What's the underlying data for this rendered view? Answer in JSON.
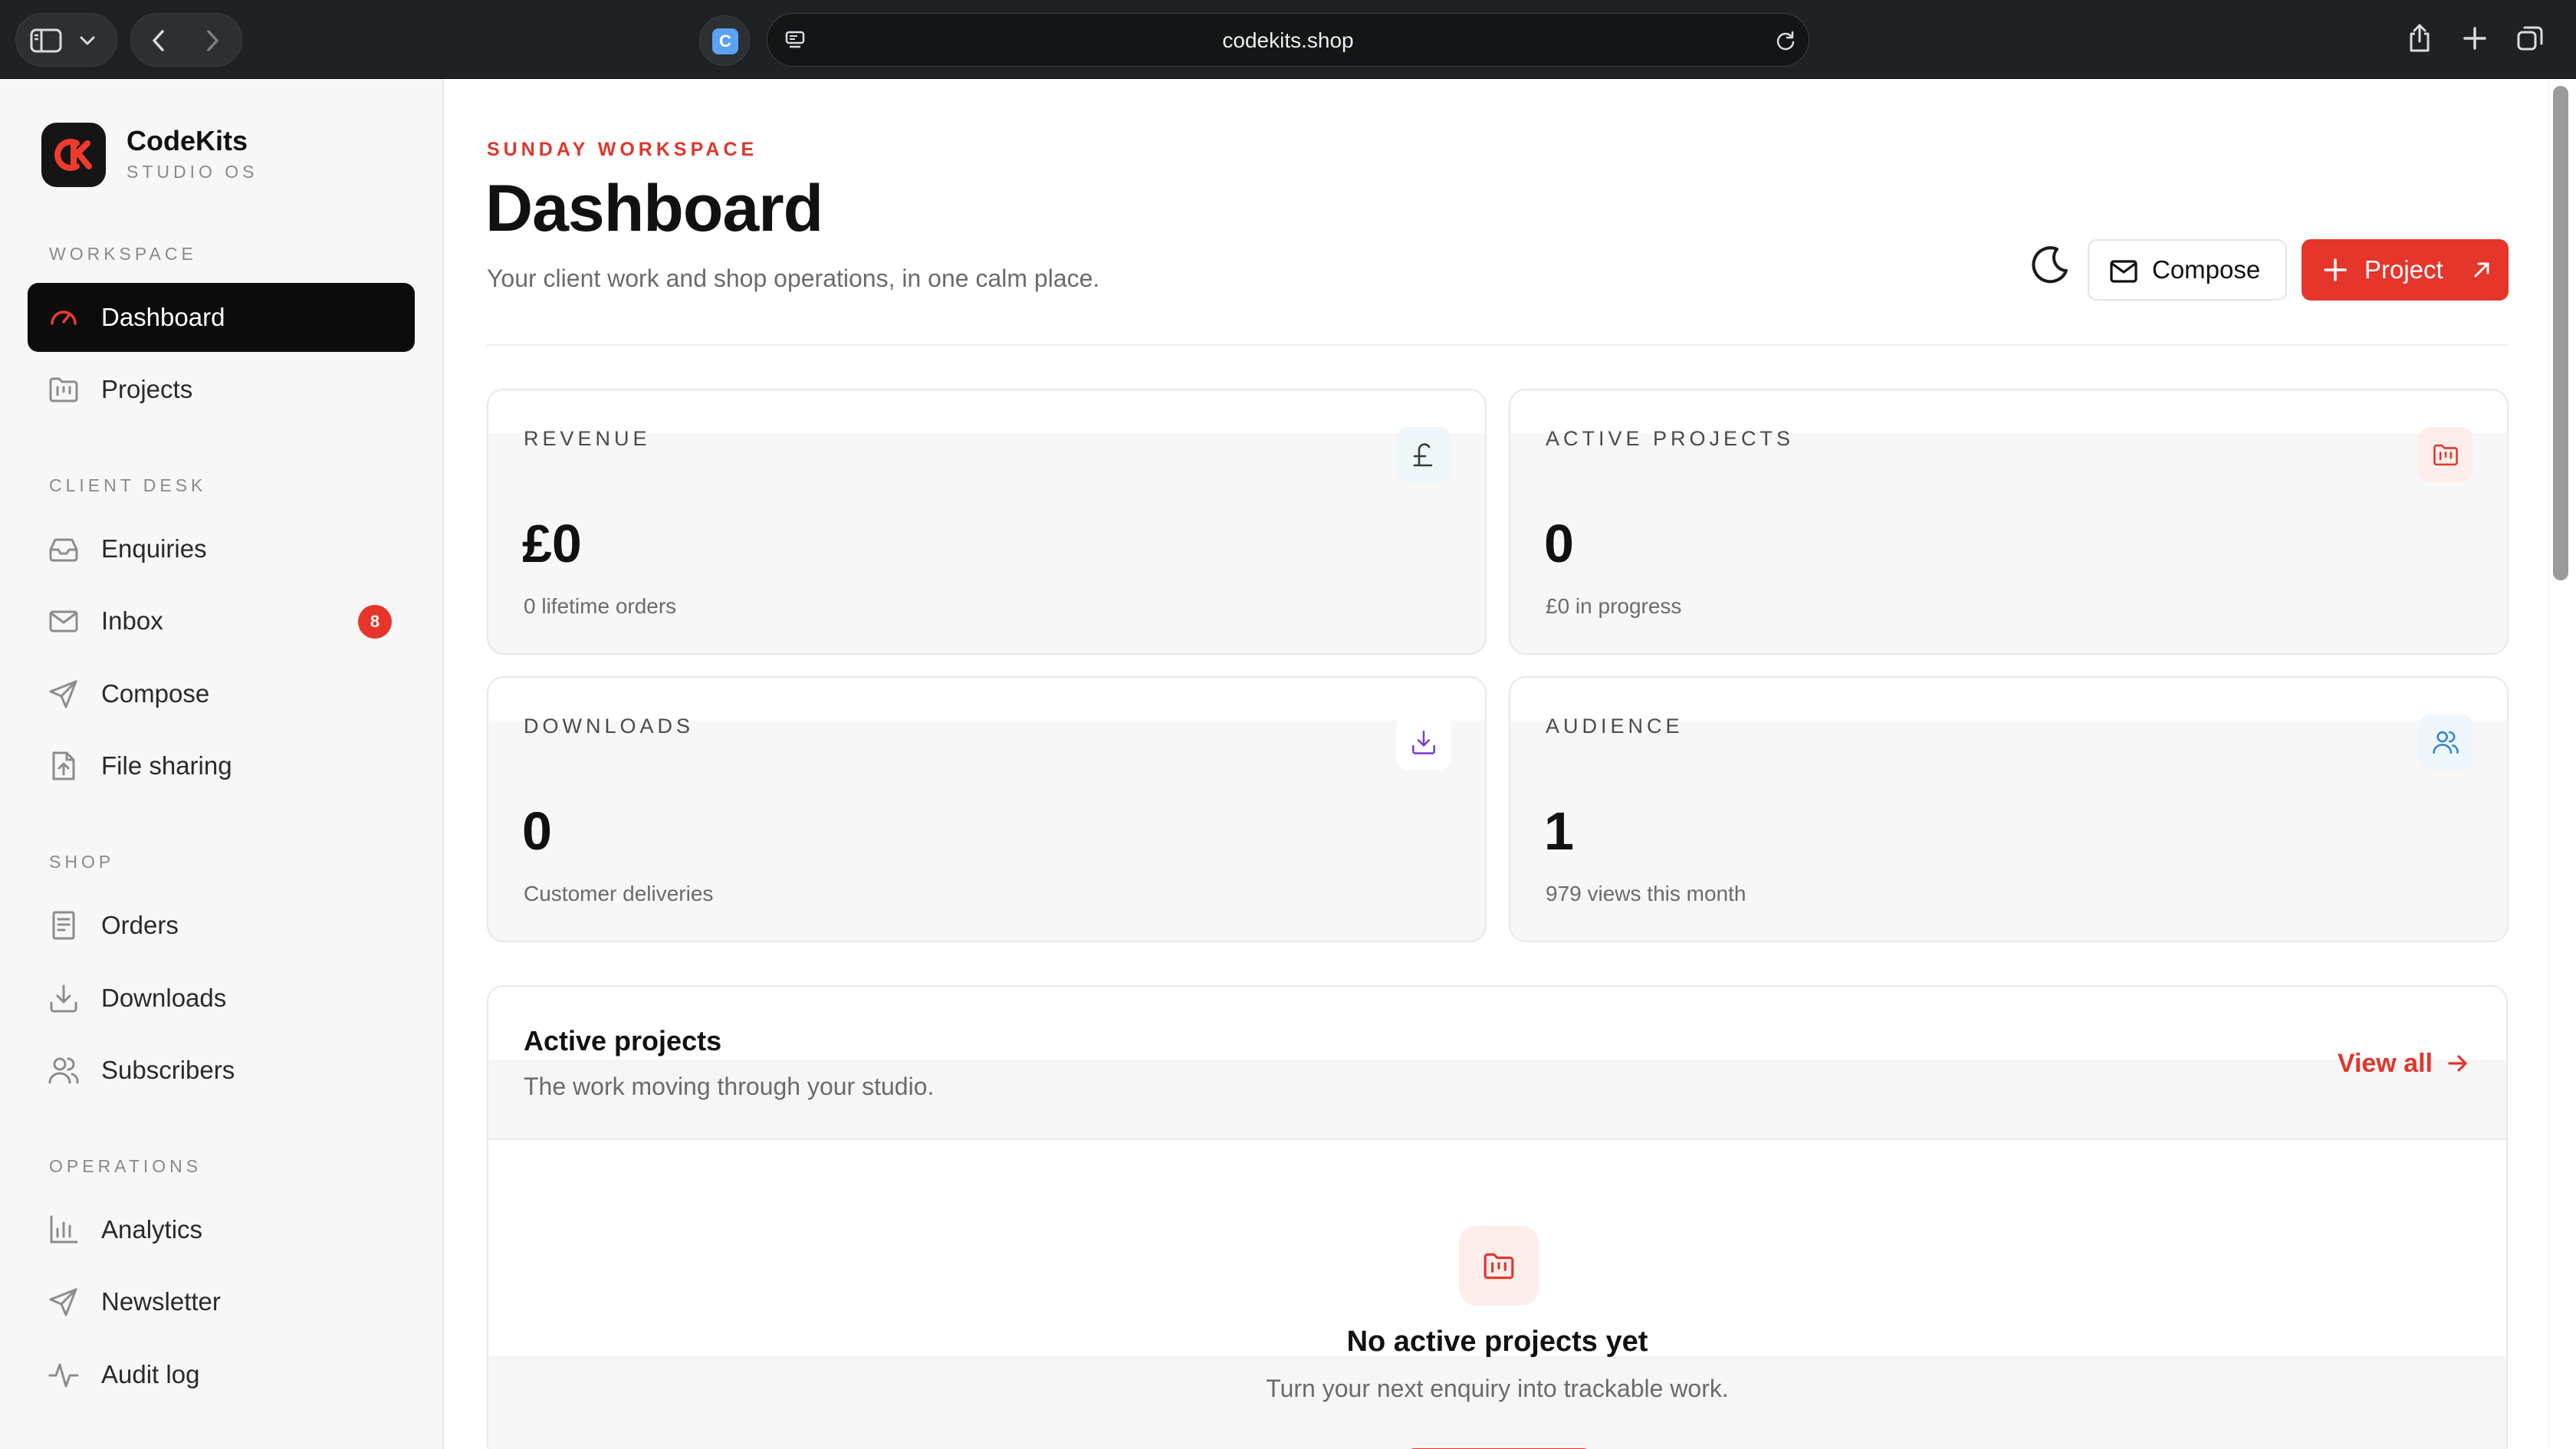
{
  "browser": {
    "url": "codekits.shop"
  },
  "brand": {
    "name": "CodeKits",
    "subtitle": "STUDIO OS"
  },
  "sidebar": {
    "sections": [
      {
        "label": "WORKSPACE"
      },
      {
        "label": "CLIENT DESK"
      },
      {
        "label": "SHOP"
      },
      {
        "label": "OPERATIONS"
      }
    ],
    "items": [
      {
        "label": "Dashboard",
        "icon": "gauge-icon",
        "active": true
      },
      {
        "label": "Projects",
        "icon": "folder-kanban-icon"
      },
      {
        "label": "Enquiries",
        "icon": "inbox-tray-icon"
      },
      {
        "label": "Inbox",
        "icon": "mail-icon",
        "badge": "8"
      },
      {
        "label": "Compose",
        "icon": "send-icon"
      },
      {
        "label": "File sharing",
        "icon": "file-upload-icon"
      },
      {
        "label": "Orders",
        "icon": "receipt-icon"
      },
      {
        "label": "Downloads",
        "icon": "download-icon"
      },
      {
        "label": "Subscribers",
        "icon": "users-icon"
      },
      {
        "label": "Analytics",
        "icon": "bar-chart-icon"
      },
      {
        "label": "Newsletter",
        "icon": "send-icon"
      },
      {
        "label": "Audit log",
        "icon": "activity-icon"
      }
    ]
  },
  "header": {
    "eyebrow": "SUNDAY WORKSPACE",
    "title": "Dashboard",
    "subtitle": "Your client work and shop operations, in one calm place.",
    "compose_label": "Compose",
    "project_label": "Project"
  },
  "stats": [
    {
      "label": "REVENUE",
      "value": "£0",
      "sub": "0 lifetime orders",
      "icon": "pound-icon",
      "accent": "#3a3a3a",
      "icon_bg": "#eef6fa"
    },
    {
      "label": "ACTIVE PROJECTS",
      "value": "0",
      "sub": "£0 in progress",
      "icon": "folder-kanban-icon",
      "accent": "#e0362b",
      "icon_bg": "#fdeeec"
    },
    {
      "label": "DOWNLOADS",
      "value": "0",
      "sub": "Customer deliveries",
      "icon": "download-icon",
      "accent": "#7a3fd6",
      "icon_bg": "#ffffff"
    },
    {
      "label": "AUDIENCE",
      "value": "1",
      "sub": "979 views this month",
      "icon": "users-icon",
      "accent": "#2f86c8",
      "icon_bg": "#eef6fb"
    }
  ],
  "projects_panel": {
    "title": "Active projects",
    "subtitle": "The work moving through your studio.",
    "view_all": "View all",
    "empty_title": "No active projects yet",
    "empty_subtitle": "Turn your next enquiry into trackable work."
  },
  "colors": {
    "accent": "#e6352b",
    "sidebar_bg": "#f7f7f7",
    "active_nav_bg": "#0c0c0c"
  }
}
